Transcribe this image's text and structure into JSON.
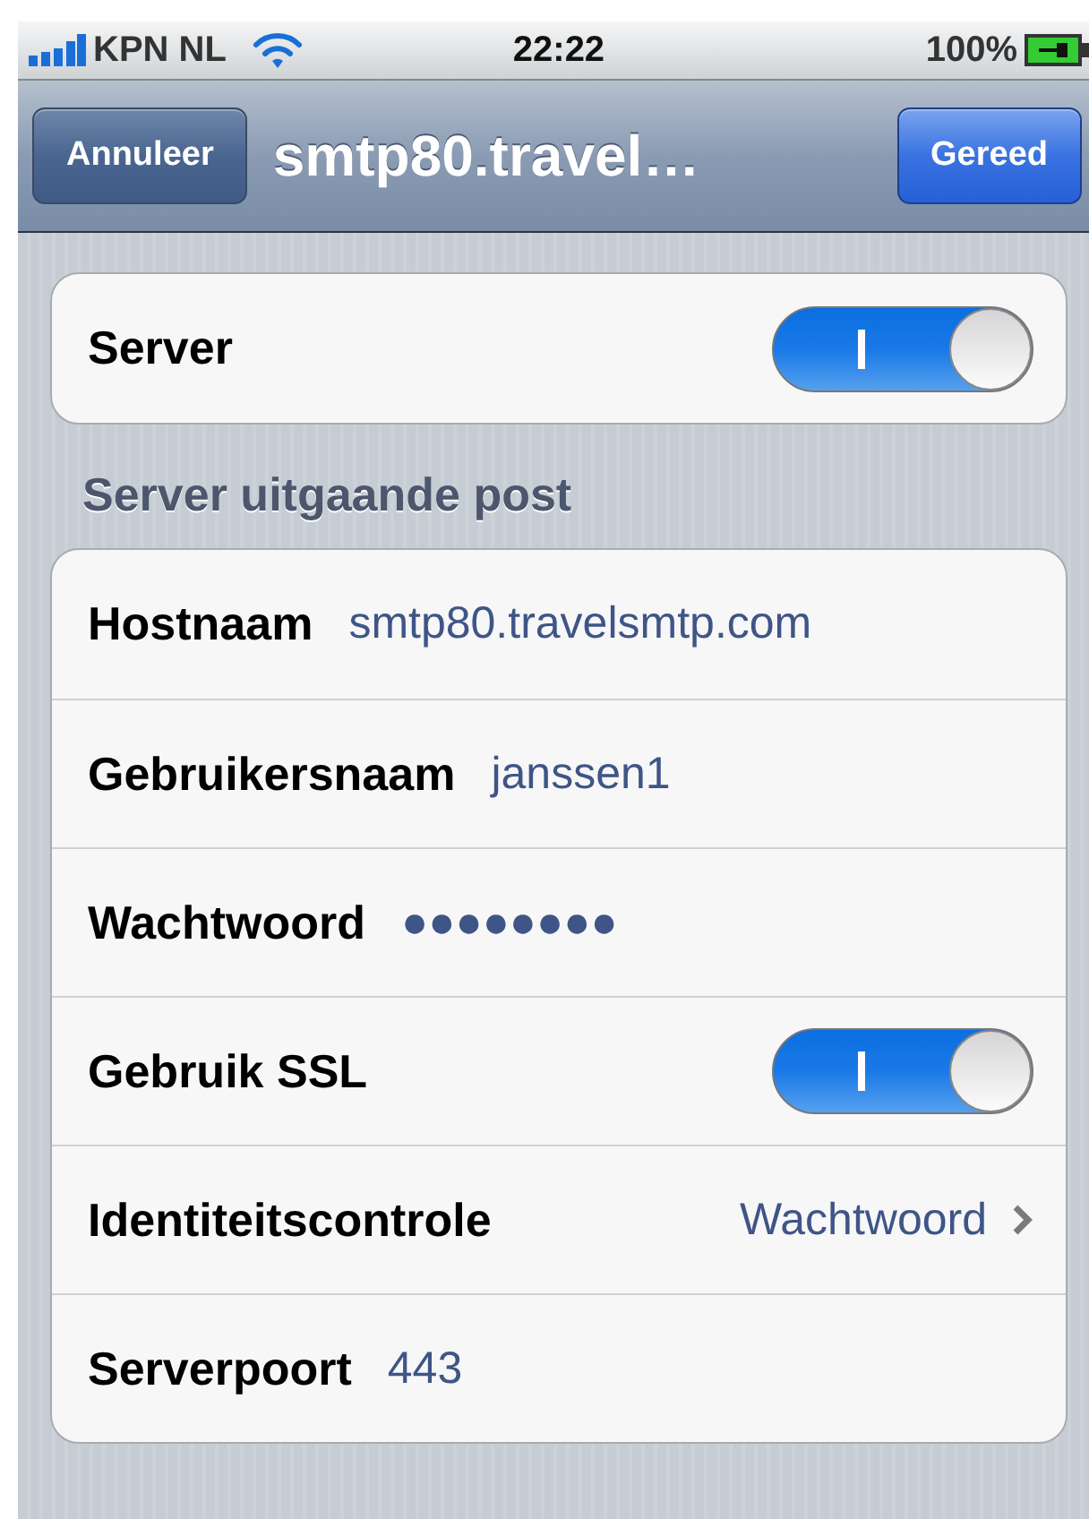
{
  "status_bar": {
    "carrier": "KPN NL",
    "time": "22:22",
    "battery": "100%"
  },
  "nav_bar": {
    "cancel": "Annuleer",
    "title": "smtp80.travel…",
    "done": "Gereed"
  },
  "groups": [
    {
      "rows": [
        {
          "kind": "toggle",
          "label": "Server",
          "on": true
        }
      ]
    },
    {
      "header": "Server uitgaande post",
      "rows": [
        {
          "kind": "value",
          "label": "Hostnaam",
          "value": "smtp80.travelsmtp.com"
        },
        {
          "kind": "value",
          "label": "Gebruikersnaam",
          "value": "janssen1"
        },
        {
          "kind": "value",
          "label": "Wachtwoord",
          "value": "●●●●●●●●"
        },
        {
          "kind": "toggle",
          "label": "Gebruik SSL",
          "on": true
        },
        {
          "kind": "disclosure",
          "label": "Identiteitscontrole",
          "value": "Wachtwoord"
        },
        {
          "kind": "value",
          "label": "Serverpoort",
          "value": "443"
        }
      ]
    }
  ]
}
